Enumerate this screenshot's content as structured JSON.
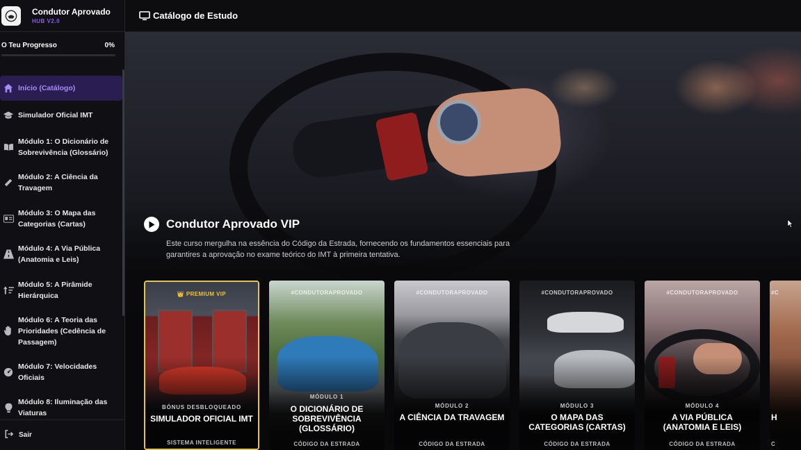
{
  "brand": {
    "title": "Condutor Aprovado",
    "subtitle": "HUB V2.0"
  },
  "progress": {
    "label": "O Teu Progresso",
    "value_text": "0%",
    "value": 0
  },
  "nav": [
    {
      "label": "Início (Catálogo)",
      "icon": "home-icon",
      "active": true
    },
    {
      "label": "Simulador Oficial IMT",
      "icon": "graduation-cap-icon"
    },
    {
      "label": "Módulo 1: O Dicionário de Sobrevivência (Glossário)",
      "icon": "book-open-icon"
    },
    {
      "label": "Módulo 2: A Ciência da Travagem",
      "icon": "ruler-icon"
    },
    {
      "label": "Módulo 3: O Mapa das Categorias (Cartas)",
      "icon": "id-card-icon"
    },
    {
      "label": "Módulo 4: A Via Pública (Anatomia e Leis)",
      "icon": "road-icon"
    },
    {
      "label": "Módulo 5: A Pirâmide Hierárquica",
      "icon": "sort-icon"
    },
    {
      "label": "Módulo 6: A Teoria das Prioridades (Cedência de Passagem)",
      "icon": "hand-icon"
    },
    {
      "label": "Módulo 7: Velocidades Oficiais",
      "icon": "gauge-icon"
    },
    {
      "label": "Módulo 8: Iluminação das Viaturas",
      "icon": "lightbulb-icon"
    }
  ],
  "logout": {
    "label": "Sair",
    "icon": "logout-icon"
  },
  "topbar": {
    "title": "Catálogo de Estudo",
    "icon": "monitor-icon"
  },
  "hero": {
    "title": "Condutor Aprovado VIP",
    "description": "Este curso mergulha na essência do Código da Estrada, fornecendo os fundamentos essenciais para garantires a aprovação no exame teórico do IMT à primeira tentativa."
  },
  "cards": [
    {
      "tag": "👑 PREMIUM VIP",
      "kicker": "BÓNUS DESBLOQUEADO",
      "title": "SIMULADOR OFICIAL IMT",
      "subtitle": "SISTEMA INTELIGENTE",
      "vip": true
    },
    {
      "tag": "#CONDUTORAPROVADO",
      "kicker": "MÓDULO 1",
      "title": "O DICIONÁRIO DE SOBREVIVÊNCIA (GLOSSÁRIO)",
      "subtitle": "CÓDIGO DA ESTRADA"
    },
    {
      "tag": "#CONDUTORAPROVADO",
      "kicker": "MÓDULO 2",
      "title": "A CIÊNCIA DA TRAVAGEM",
      "subtitle": "CÓDIGO DA ESTRADA"
    },
    {
      "tag": "#CONDUTORAPROVADO",
      "kicker": "MÓDULO 3",
      "title": "O MAPA DAS CATEGORIAS (CARTAS)",
      "subtitle": "CÓDIGO DA ESTRADA"
    },
    {
      "tag": "#CONDUTORAPROVADO",
      "kicker": "MÓDULO 4",
      "title": "A VIA PÚBLICA (ANATOMIA E LEIS)",
      "subtitle": "CÓDIGO DA ESTRADA"
    },
    {
      "tag": "#C",
      "kicker": "",
      "title": "H",
      "subtitle": "C"
    }
  ],
  "colors": {
    "accent": "#8b5cf6",
    "vip_gold": "#e6c64a",
    "active_bg": "#2a1d52"
  }
}
